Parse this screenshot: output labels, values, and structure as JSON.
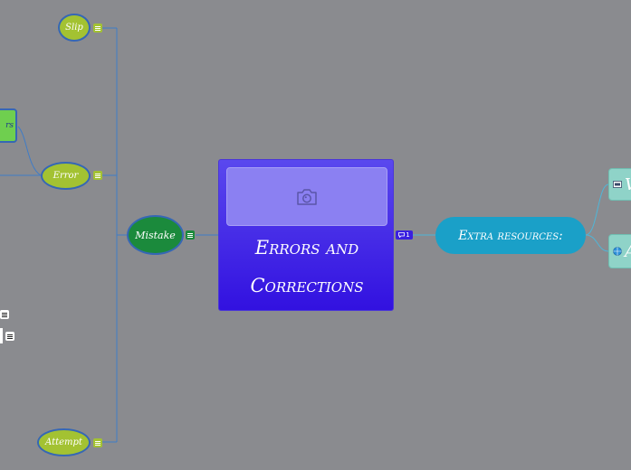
{
  "central": {
    "title_line1": "Errors and",
    "title_line2": "Corrections",
    "comment_count": "1",
    "image_icon": "camera-icon"
  },
  "left_nodes": {
    "slip": "Slip",
    "error": "Error",
    "mistake": "Mistake",
    "attempt": "Attempt",
    "partial_green": "rs"
  },
  "right_nodes": {
    "extra_resources": "Extra resources:",
    "child1_initial": "V",
    "child2_initial": "A"
  },
  "colors": {
    "background": "#8a8b8f",
    "central": "#3211e0",
    "lime": "#a3c232",
    "green": "#1b8a3c",
    "cyan": "#1aa0c8",
    "teal": "#8fd3c8",
    "link": "#3f7cc7"
  }
}
